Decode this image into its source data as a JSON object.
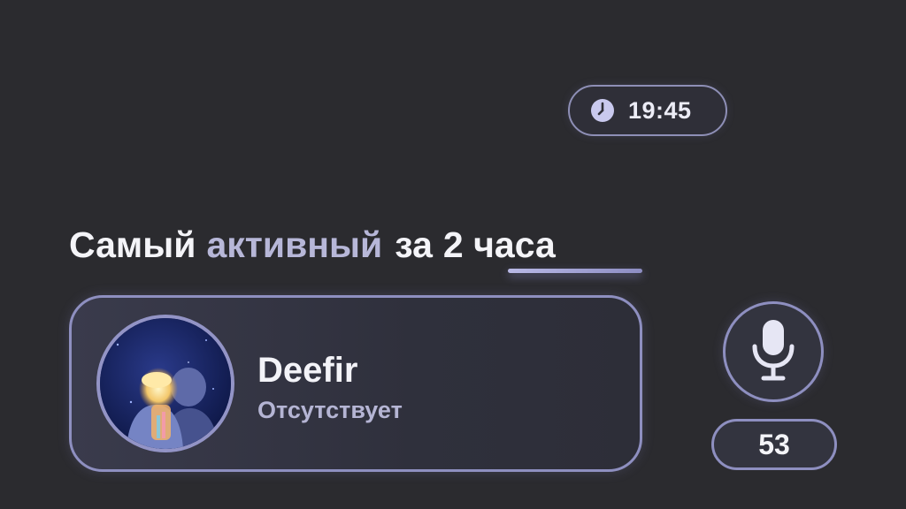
{
  "clock": {
    "time": "19:45",
    "icon": "clock-icon"
  },
  "headline": {
    "part1": "Самый",
    "accent": "активный",
    "part2": "за",
    "period": "2 часа"
  },
  "user": {
    "name": "Deefir",
    "status": "Отсутствует",
    "avatar": "avatar-image"
  },
  "voice": {
    "icon": "microphone-icon",
    "count": "53"
  },
  "colors": {
    "background": "#2b2b2f",
    "border": "#8e8fc0",
    "accent_text": "#b7b7d8",
    "text": "#f4f4f8"
  }
}
